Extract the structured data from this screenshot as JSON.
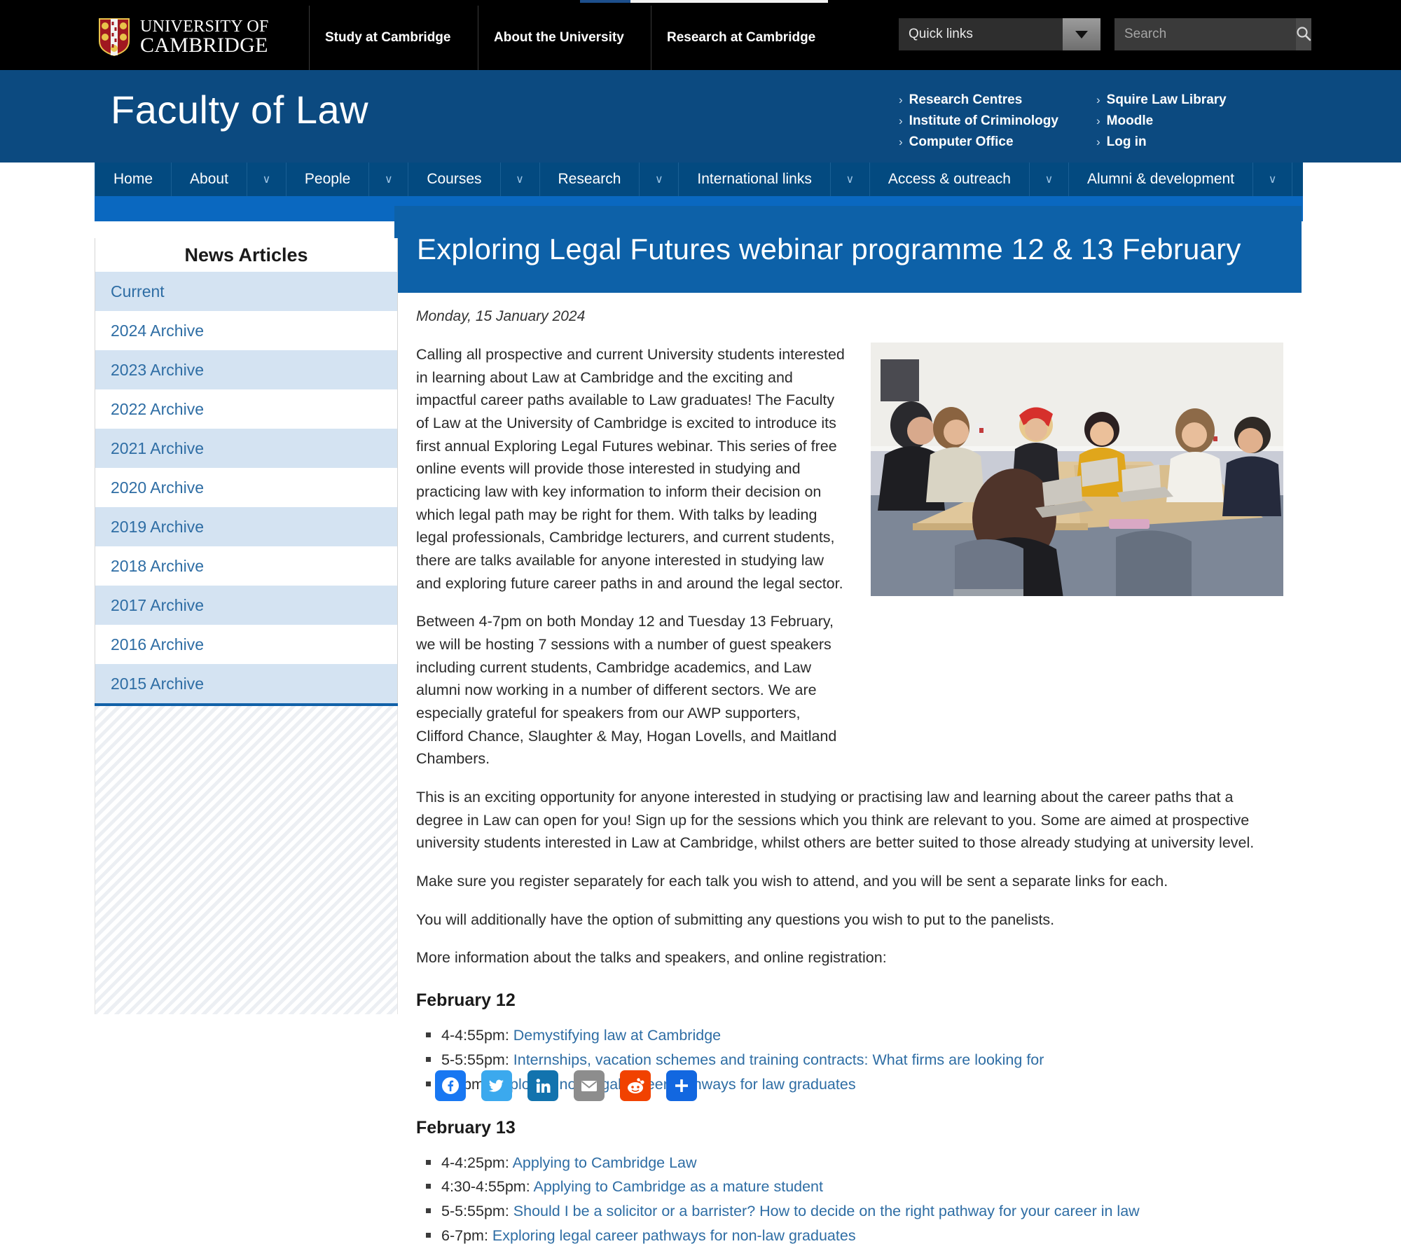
{
  "university_bar": {
    "logo_line1": "UNIVERSITY OF",
    "logo_line2": "CAMBRIDGE",
    "nav": [
      {
        "label": "Study at Cambridge"
      },
      {
        "label": "About the University"
      },
      {
        "label": "Research at Cambridge"
      }
    ],
    "quick_links_label": "Quick links",
    "search_placeholder": "Search",
    "search_value": ""
  },
  "faculty_banner": {
    "title": "Faculty of Law",
    "links_col1": [
      {
        "label": "Research Centres"
      },
      {
        "label": "Institute of Criminology"
      },
      {
        "label": "Computer Office"
      }
    ],
    "links_col2": [
      {
        "label": "Squire Law Library"
      },
      {
        "label": "Moodle"
      },
      {
        "label": "Log in"
      }
    ],
    "chevron": "›"
  },
  "main_nav": [
    {
      "label": "Home",
      "caret": false
    },
    {
      "label": "About",
      "caret": true
    },
    {
      "label": "People",
      "caret": true
    },
    {
      "label": "Courses",
      "caret": true
    },
    {
      "label": "Research",
      "caret": true
    },
    {
      "label": "International links",
      "caret": true
    },
    {
      "label": "Access & outreach",
      "caret": true
    },
    {
      "label": "Alumni & development",
      "caret": true
    }
  ],
  "nav_caret_glyph": "∨",
  "page_title": "Exploring Legal Futures webinar programme 12 & 13 February",
  "sidebar": {
    "heading": "News Articles",
    "items": [
      {
        "label": "Current"
      },
      {
        "label": "2024 Archive"
      },
      {
        "label": "2023 Archive"
      },
      {
        "label": "2022 Archive"
      },
      {
        "label": "2021 Archive"
      },
      {
        "label": "2020 Archive"
      },
      {
        "label": "2019 Archive"
      },
      {
        "label": "2018 Archive"
      },
      {
        "label": "2017 Archive"
      },
      {
        "label": "2016 Archive"
      },
      {
        "label": "2015 Archive"
      }
    ]
  },
  "article": {
    "date": "Monday, 15 January 2024",
    "paragraph_1": "Calling all prospective and current University students interested in learning about Law at Cambridge and the exciting and impactful career paths available to Law graduates! The Faculty of Law at the University of Cambridge is excited to introduce its first annual Exploring Legal Futures webinar. This series of free online events will provide those interested in studying and practicing law with key information to inform their decision on which legal path may be right for them. With talks by leading legal professionals, Cambridge lecturers, and current students, there are talks available for anyone interested in studying law and exploring future career paths in and around the legal sector.",
    "paragraph_2": "Between 4-7pm on both Monday 12 and Tuesday 13 February, we will be hosting 7 sessions with a number of guest speakers including current students, Cambridge academics, and Law alumni now working in a number of different sectors. We are especially grateful for speakers from our AWP supporters, Clifford Chance, Slaughter & May, Hogan Lovells, and Maitland Chambers.",
    "paragraph_3": "This is an exciting opportunity for anyone interested in studying or practising law and learning about the career paths that a degree in Law can open for you! Sign up for the sessions which you think are relevant to you. Some are aimed at prospective university students interested in Law at Cambridge, whilst others are better suited to those already studying at university level.",
    "paragraph_4": "Make sure you register separately for each talk you wish to attend, and you will be sent a separate links for each.",
    "paragraph_5": "You will additionally have the option of submitting any questions you wish to put to the panelists.",
    "paragraph_6": "More information about the talks and speakers, and online registration:",
    "heading_feb12": "February 12",
    "sessions_feb12": [
      {
        "time": "4-4:55pm: ",
        "link": "Demystifying law at Cambridge"
      },
      {
        "time": "5-5:55pm: ",
        "link": "Internships, vacation schemes and training contracts: What firms are looking for"
      },
      {
        "time": "6-7pm: ",
        "link": "Exploring non-legal career pathways for law graduates"
      }
    ],
    "heading_feb13": "February 13",
    "sessions_feb13": [
      {
        "time": "4-4:25pm: ",
        "link": "Applying to Cambridge Law"
      },
      {
        "time": "4:30-4:55pm: ",
        "link": "Applying to Cambridge as a mature student"
      },
      {
        "time": "5-5:55pm: ",
        "link": "Should I be a solicitor or a barrister? How to decide on the right pathway for your career in law"
      },
      {
        "time": "6-7pm: ",
        "link": "Exploring legal career pathways for non-law graduates"
      }
    ],
    "photo_alt": "Students seated around a seminar table with laptops"
  },
  "share_buttons": [
    {
      "name": "Facebook",
      "color": "#1877F2"
    },
    {
      "name": "Twitter",
      "color": "#3BA9EE"
    },
    {
      "name": "LinkedIn",
      "color": "#1273AE"
    },
    {
      "name": "Email",
      "color": "#8D8D8D"
    },
    {
      "name": "Reddit",
      "color": "#F14200"
    },
    {
      "name": "Share",
      "color": "#1267E0"
    }
  ],
  "colors": {
    "faculty_blue": "#0c4a80",
    "nav_blue": "#034a80",
    "accent_blue": "#0a68c0",
    "title_blue": "#0d61a8",
    "link_blue": "#2e6da4",
    "sidebar_stripe": "#d4e3f2"
  }
}
